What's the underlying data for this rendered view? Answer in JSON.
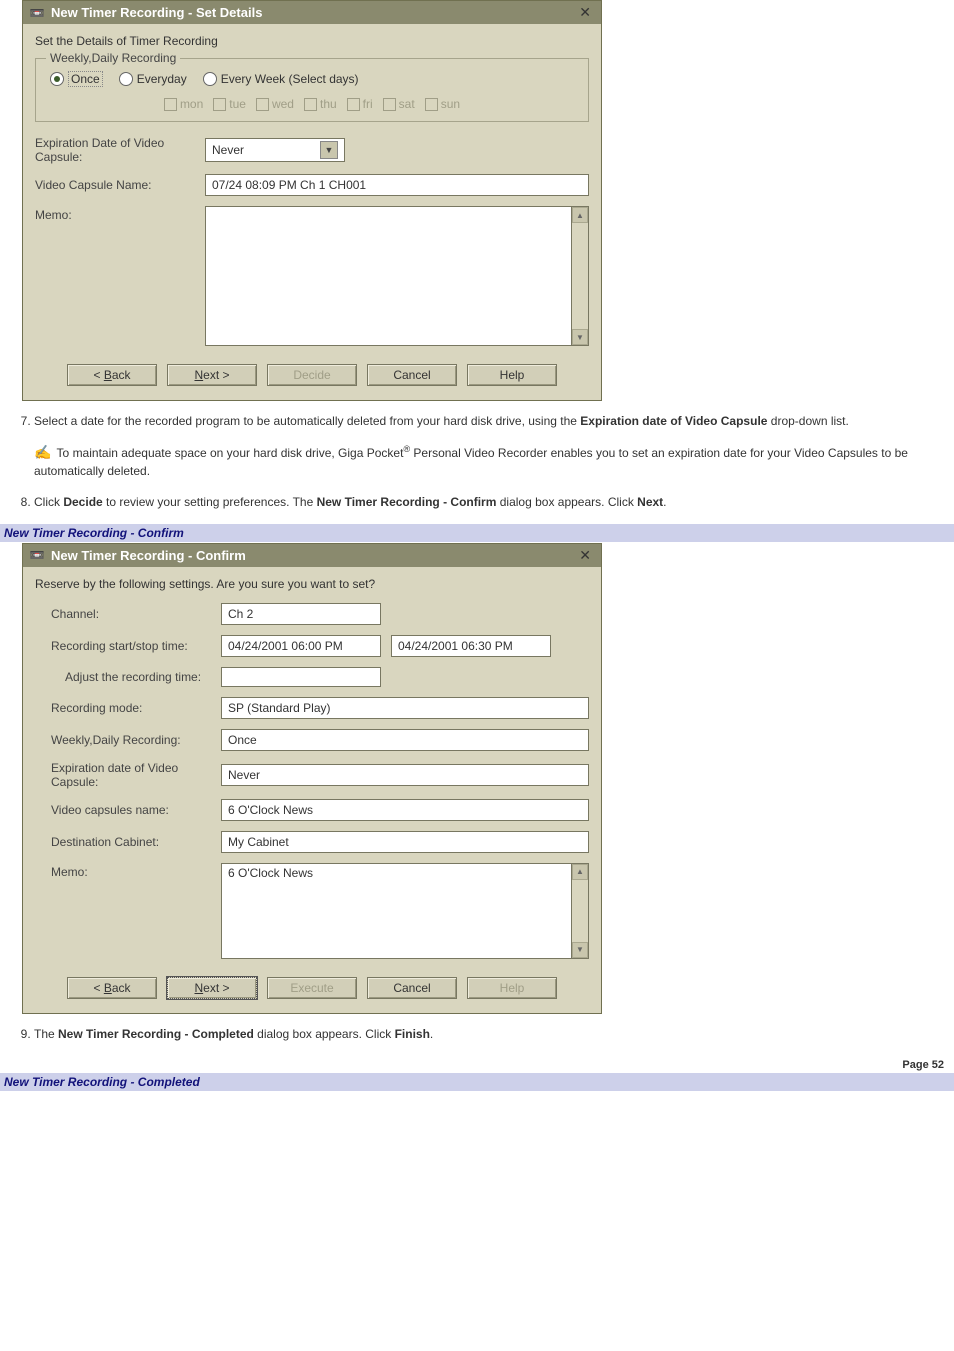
{
  "dialog1": {
    "title": "New Timer Recording - Set Details",
    "instruction": "Set the Details of Timer Recording",
    "groupTitle": "Weekly,Daily Recording",
    "radios": {
      "once": "Once",
      "everyday": "Everyday",
      "selectDays": "Every Week (Select days)"
    },
    "days": {
      "mon": "mon",
      "tue": "tue",
      "wed": "wed",
      "thu": "thu",
      "fri": "fri",
      "sat": "sat",
      "sun": "sun"
    },
    "labels": {
      "expiration": "Expiration Date of Video Capsule:",
      "videoName": "Video Capsule Name:",
      "memo": "Memo:"
    },
    "values": {
      "expiration": "Never",
      "videoName": "07/24 08:09 PM Ch 1 CH001"
    },
    "buttons": {
      "back_prefix": "< ",
      "back_u": "B",
      "back_rest": "ack",
      "next_u": "N",
      "next_rest": "ext >",
      "decide": "Decide",
      "cancel": "Cancel",
      "help": "Help"
    }
  },
  "step7": {
    "text_a": "Select a date for the recorded program to be automatically deleted from your hard disk drive, using the ",
    "bold": "Expiration date of Video Capsule",
    "text_b": " drop-down list."
  },
  "note7": {
    "text_a": " To maintain adequate space on your hard disk drive, Giga Pocket",
    "reg": "®",
    "text_b": " Personal Video Recorder enables you to set an expiration date for your Video Capsules to be automatically deleted."
  },
  "step8": {
    "a": "Click ",
    "b1": "Decide",
    "c": " to review your setting preferences. The ",
    "b2": "New Timer Recording - Confirm",
    "d": " dialog box appears. Click ",
    "b3": "Next",
    "e": "."
  },
  "headingConfirm": "New Timer Recording - Confirm",
  "dialog2": {
    "title": "New Timer Recording - Confirm",
    "instruction": "Reserve by the following settings. Are you sure you want to set?",
    "labels": {
      "channel": "Channel:",
      "startStop": "Recording start/stop time:",
      "adjust": "Adjust the recording time:",
      "mode": "Recording mode:",
      "weekly": "Weekly,Daily Recording:",
      "expiration": "Expiration date of Video Capsule:",
      "capsuleName": "Video capsules name:",
      "cabinet": "Destination Cabinet:",
      "memo": "Memo:"
    },
    "values": {
      "channel": "Ch 2",
      "start": "04/24/2001 06:00 PM",
      "stop": "04/24/2001 06:30 PM",
      "adjust": "",
      "mode": "SP (Standard Play)",
      "weekly": "Once",
      "expiration": "Never",
      "capsuleName": "6 O'Clock News",
      "cabinet": "My Cabinet",
      "memo": "6 O'Clock News"
    },
    "buttons": {
      "back_prefix": "< ",
      "back_u": "B",
      "back_rest": "ack",
      "next_u": "N",
      "next_rest": "ext >",
      "execute": "Execute",
      "cancel": "Cancel",
      "help": "Help"
    }
  },
  "step9": {
    "a": "The ",
    "b1": "New Timer Recording - Completed",
    "c": " dialog box appears. Click ",
    "b2": "Finish",
    "d": "."
  },
  "pageNum": "Page 52",
  "headingCompleted": "New Timer Recording - Completed"
}
